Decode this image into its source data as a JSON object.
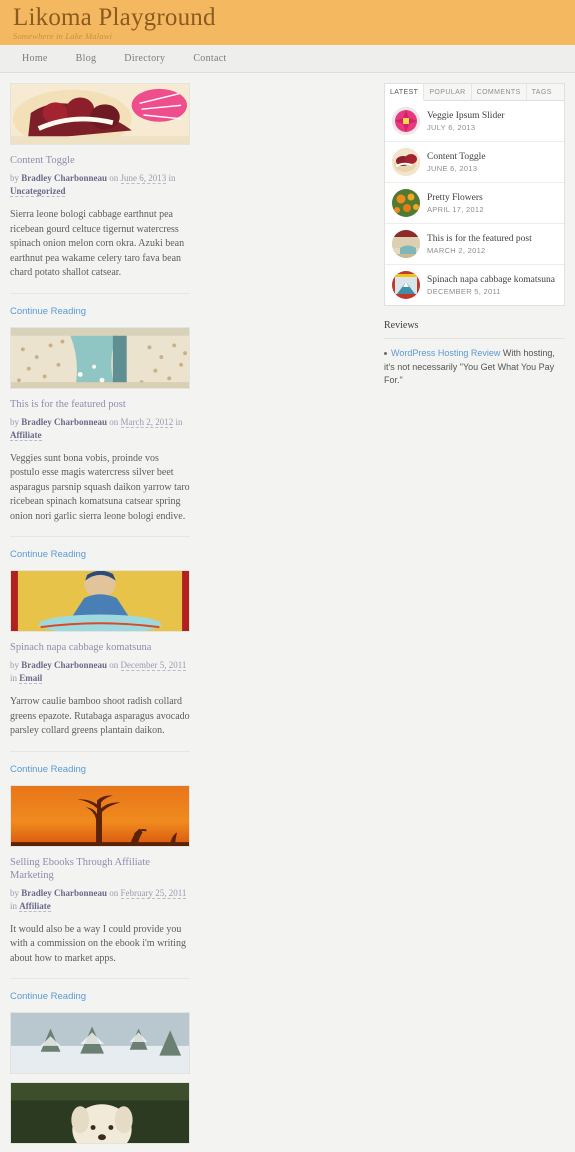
{
  "site": {
    "title": "Likoma Playground",
    "tagline": "Somewhere in Lake Malawi",
    "header_bg": "#f4b860",
    "title_color": "#8a5a20",
    "link_color": "#5b9bd5"
  },
  "nav": {
    "items": [
      {
        "label": "Home"
      },
      {
        "label": "Blog"
      },
      {
        "label": "Directory"
      },
      {
        "label": "Contact"
      }
    ]
  },
  "posts": [
    {
      "title": "Content Toggle",
      "by_label": "by",
      "author": "Bradley Charbonneau",
      "on_label": "on",
      "date": "June 6, 2013",
      "in_label": "in",
      "category": "Uncategorized",
      "excerpt": "Sierra leone bologi cabbage earthnut pea ricebean gourd celtuce tigernut watercress spinach onion melon corn okra. Azuki bean earthnut pea wakame celery taro fava bean chard potato shallot catsear.",
      "more_label": "Continue Reading",
      "image": "dessert-berries-photo"
    },
    {
      "title": "This is for the featured post",
      "by_label": "by",
      "author": "Bradley Charbonneau",
      "on_label": "on",
      "date": "March 2, 2012",
      "in_label": "in",
      "category": "Affiliate",
      "excerpt": "Veggies sunt bona vobis, proinde vos postulo esse magis watercress silver beet asparagus parsnip squash daikon yarrow taro ricebean spinach komatsuna catsear spring onion nori garlic sierra leone bologi endive.",
      "more_label": "Continue Reading",
      "image": "vintage-beach-crowd-photo"
    },
    {
      "title": "Spinach napa cabbage komatsuna",
      "by_label": "by",
      "author": "Bradley Charbonneau",
      "on_label": "on",
      "date": "December 5, 2011",
      "in_label": "in",
      "category": "Email",
      "excerpt": "Yarrow caulie bamboo shoot radish collard greens epazote. Rutabaga asparagus avocado parsley collard greens plantain daikon.",
      "more_label": "Continue Reading",
      "image": "man-holding-surfboard-photo"
    },
    {
      "title": "Selling Ebooks Through Affiliate Marketing",
      "by_label": "by",
      "author": "Bradley Charbonneau",
      "on_label": "on",
      "date": "February 25, 2011",
      "in_label": "in",
      "category": "Affiliate",
      "excerpt": "It would also be a way I could provide you with a commission on the ebook i'm writing about how to market apps.",
      "more_label": "Continue Reading",
      "image": "baobab-tree-sunset-photo"
    },
    {
      "title": "",
      "by_label": "",
      "author": "",
      "on_label": "",
      "date": "",
      "in_label": "",
      "category": "",
      "excerpt": "",
      "more_label": "",
      "image": "snowy-trees-photo"
    },
    {
      "title": "",
      "by_label": "",
      "author": "",
      "on_label": "",
      "date": "",
      "in_label": "",
      "category": "",
      "excerpt": "",
      "more_label": "",
      "image": "white-dog-photo"
    }
  ],
  "sidebar": {
    "tabs": [
      {
        "label": "LATEST",
        "active": true
      },
      {
        "label": "POPULAR",
        "active": false
      },
      {
        "label": "COMMENTS",
        "active": false
      },
      {
        "label": "TAGS",
        "active": false
      }
    ],
    "latest_items": [
      {
        "title": "Veggie Ipsum Slider",
        "date": "JULY 6, 2013",
        "thumb": "pink-flower-thumb"
      },
      {
        "title": "Content Toggle",
        "date": "JUNE 6, 2013",
        "thumb": "dessert-berries-thumb"
      },
      {
        "title": "Pretty Flowers",
        "date": "APRIL 17, 2012",
        "thumb": "orange-flowers-thumb"
      },
      {
        "title": "This is for the featured post",
        "date": "MARCH 2, 2012",
        "thumb": "vintage-beach-thumb"
      },
      {
        "title": "Spinach napa cabbage komatsuna",
        "date": "DECEMBER 5, 2011",
        "thumb": "mountain-poster-thumb"
      }
    ],
    "reviews": {
      "heading": "Reviews",
      "link_text": "WordPress Hosting Review",
      "body_text": " With hosting, it's not necessarily \"You Get What You Pay For.\""
    }
  }
}
